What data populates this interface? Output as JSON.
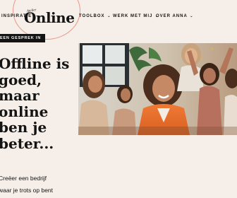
{
  "header": {
    "logo": {
      "small_text": "Atelier",
      "main_text": "Online"
    },
    "nav": [
      {
        "label": "INSPIRATIE",
        "has_dropdown": true
      },
      {
        "label": "TOOLBOX",
        "has_dropdown": true
      },
      {
        "label": "WERK MET MIJ",
        "has_dropdown": true
      },
      {
        "label": "OVER ANNA",
        "has_dropdown": true
      }
    ]
  },
  "cta": {
    "label": "EEN GESPREK IN"
  },
  "hero": {
    "title_lines": [
      "Offline is",
      "goed,",
      "maar",
      "online",
      "ben je",
      "beter..."
    ],
    "subtitle_lines": [
      "Creëer een bedrijf",
      "waar je trots op bent"
    ]
  },
  "photo": {
    "icon": "hero-photo-icon"
  },
  "colors": {
    "background": "#f6efe9",
    "text": "#141414",
    "accent": "#e9988b",
    "button": "#141414"
  }
}
